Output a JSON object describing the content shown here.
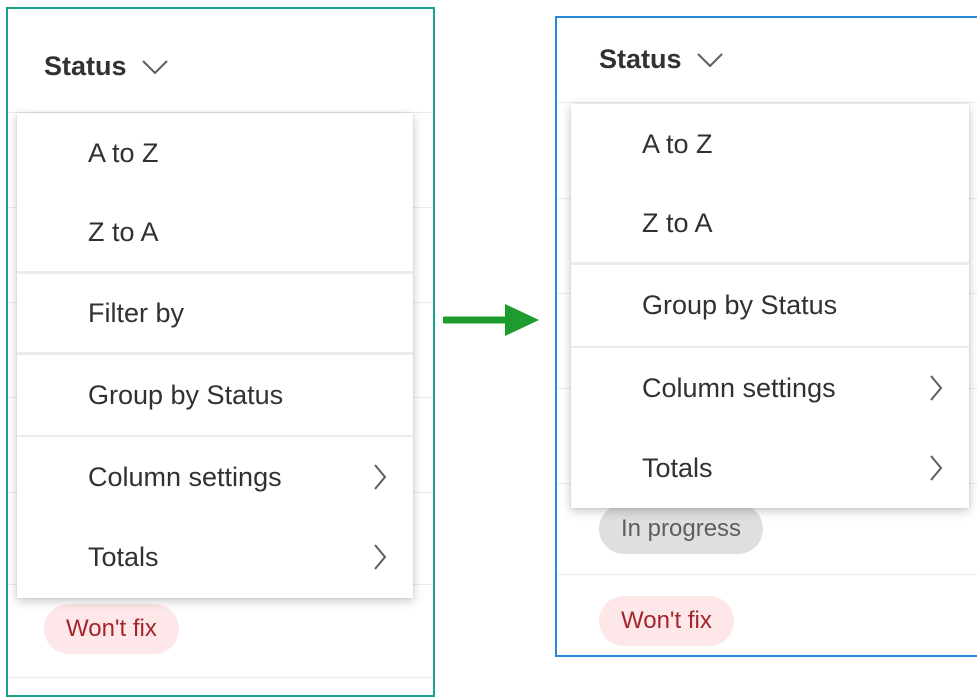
{
  "left_panel": {
    "column_header": "Status",
    "menu": {
      "sort_asc": "A to Z",
      "sort_desc": "Z to A",
      "filter": "Filter by",
      "group": "Group by Status",
      "column_settings": "Column settings",
      "totals": "Totals"
    },
    "pill_wontfix": "Won't fix"
  },
  "right_panel": {
    "column_header": "Status",
    "menu": {
      "sort_asc": "A to Z",
      "sort_desc": "Z to A",
      "group": "Group by Status",
      "column_settings": "Column settings",
      "totals": "Totals"
    },
    "pill_inprogress": "In progress",
    "pill_wontfix": "Won't fix"
  },
  "colors": {
    "left_border": "#1aa38a",
    "right_border": "#2b88d8",
    "arrow": "#1e9b2e",
    "wontfix_bg": "#fde7e9",
    "wontfix_text": "#a4262c"
  },
  "icons": [
    "chevron-down-icon",
    "chevron-right-icon",
    "arrow-right-icon"
  ]
}
